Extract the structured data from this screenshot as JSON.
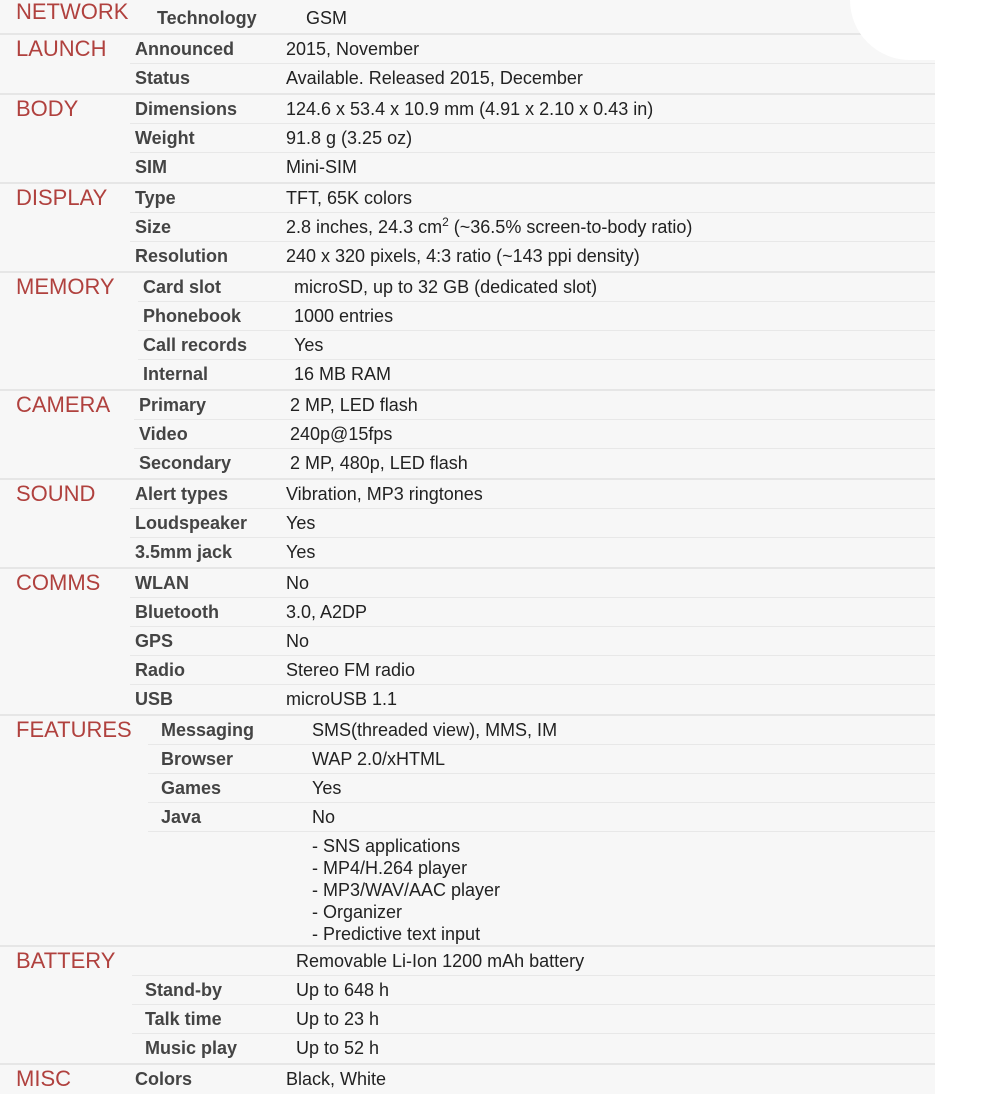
{
  "sections": [
    {
      "name": "NETWORK",
      "rows": [
        {
          "label": "Technology",
          "value": "GSM"
        }
      ]
    },
    {
      "name": "LAUNCH",
      "rows": [
        {
          "label": "Announced",
          "value": "2015, November"
        },
        {
          "label": "Status",
          "value": "Available. Released 2015, December"
        }
      ]
    },
    {
      "name": "BODY",
      "rows": [
        {
          "label": "Dimensions",
          "value": "124.6 x 53.4 x 10.9 mm (4.91 x 2.10 x 0.43 in)"
        },
        {
          "label": "Weight",
          "value": "91.8 g (3.25 oz)"
        },
        {
          "label": "SIM",
          "value": "Mini-SIM"
        }
      ]
    },
    {
      "name": "DISPLAY",
      "rows": [
        {
          "label": "Type",
          "value": "TFT, 65K colors"
        },
        {
          "label": "Size",
          "value": "2.8 inches, 24.3 cm",
          "sup": "2",
          "value_post": " (~36.5% screen-to-body ratio)"
        },
        {
          "label": "Resolution",
          "value": "240 x 320 pixels, 4:3 ratio (~143 ppi density)"
        }
      ]
    },
    {
      "name": "MEMORY",
      "rows": [
        {
          "label": "Card slot",
          "value": "microSD, up to 32 GB (dedicated slot)"
        },
        {
          "label": "Phonebook",
          "value": "1000 entries"
        },
        {
          "label": "Call records",
          "value": "Yes"
        },
        {
          "label": "Internal",
          "value": "16 MB RAM"
        }
      ]
    },
    {
      "name": "CAMERA",
      "rows": [
        {
          "label": "Primary",
          "value": "2 MP, LED flash"
        },
        {
          "label": "Video",
          "value": "240p@15fps"
        },
        {
          "label": "Secondary",
          "value": "2 MP, 480p, LED flash"
        }
      ]
    },
    {
      "name": "SOUND",
      "rows": [
        {
          "label": "Alert types",
          "value": "Vibration, MP3 ringtones"
        },
        {
          "label": "Loudspeaker",
          "value": "Yes"
        },
        {
          "label": "3.5mm jack",
          "value": "Yes"
        }
      ]
    },
    {
      "name": "COMMS",
      "rows": [
        {
          "label": "WLAN",
          "value": "No"
        },
        {
          "label": "Bluetooth",
          "value": "3.0, A2DP"
        },
        {
          "label": "GPS",
          "value": "No"
        },
        {
          "label": "Radio",
          "value": "Stereo FM radio"
        },
        {
          "label": "USB",
          "value": "microUSB 1.1"
        }
      ]
    },
    {
      "name": "FEATURES",
      "rows": [
        {
          "label": "Messaging",
          "value": "SMS(threaded view), MMS, IM"
        },
        {
          "label": "Browser",
          "value": "WAP 2.0/xHTML"
        },
        {
          "label": "Games",
          "value": "Yes"
        },
        {
          "label": "Java",
          "value": "No"
        }
      ],
      "extra": [
        "- SNS applications",
        "- MP4/H.264 player",
        "- MP3/WAV/AAC player",
        "- Organizer",
        "- Predictive text input"
      ]
    },
    {
      "name": "BATTERY",
      "rows": [
        {
          "label": "",
          "value": "Removable Li-Ion 1200 mAh battery"
        },
        {
          "label": "Stand-by",
          "value": "Up to 648 h"
        },
        {
          "label": "Talk time",
          "value": "Up to 23 h"
        },
        {
          "label": "Music play",
          "value": "Up to 52 h"
        }
      ]
    },
    {
      "name": "MISC",
      "rows": [
        {
          "label": "Colors",
          "value": "Black, White"
        }
      ]
    }
  ],
  "colors": {
    "category": "#b0413e",
    "background": "#f7f7f7",
    "label": "#444444",
    "value": "#222222"
  }
}
